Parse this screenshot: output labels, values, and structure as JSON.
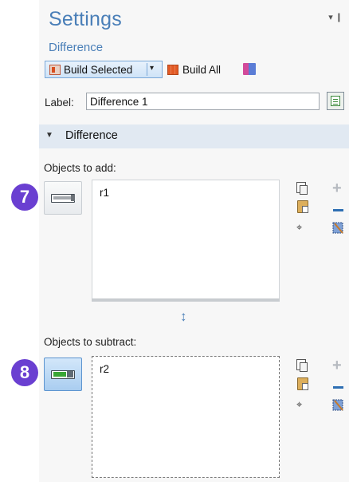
{
  "header": {
    "title": "Settings",
    "subtitle": "Difference",
    "pin_glyph": "▾ ❙"
  },
  "toolbar": {
    "build_selected_label": "Build Selected",
    "dropdown_glyph": "▾",
    "build_all_label": "Build All",
    "extra_icon": "geometry-settings-icon"
  },
  "label_row": {
    "label": "Label:",
    "value": "Difference 1"
  },
  "section": {
    "title": "Difference",
    "expanded": true
  },
  "objects_to_add": {
    "caption": "Objects to add:",
    "badge": "7",
    "items": [
      "r1"
    ],
    "active": false
  },
  "objects_to_subtract": {
    "caption": "Objects to subtract:",
    "badge": "8",
    "items": [
      "r2"
    ],
    "active": true
  },
  "resize_glyph": "↕",
  "side_glyphs": {
    "plus": "+",
    "zoom": "⌖"
  },
  "colors": {
    "accent": "#4a7fb8",
    "badge": "#6a3fd1",
    "section_bar": "#e1e9f2",
    "toggle_active": "#3aa635"
  }
}
